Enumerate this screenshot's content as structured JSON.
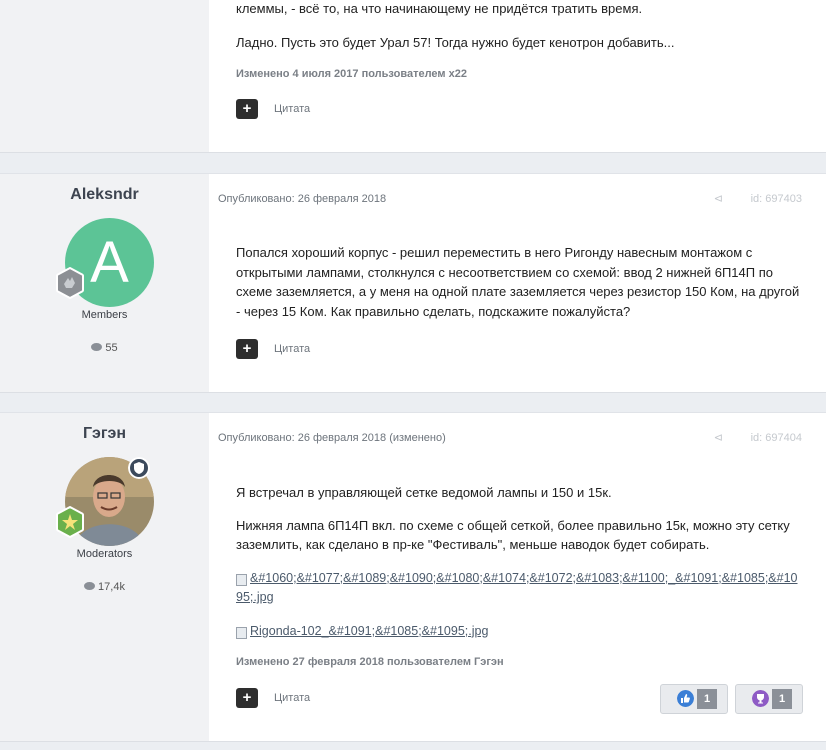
{
  "post1": {
    "lines": [
      "клеммы, - всё то, на что начинающему не придётся тратить время.",
      "Ладно. Пусть это будет Урал 57! Тогда нужно будет кенотрон добавить..."
    ],
    "edited": "Изменено 4 июля 2017 пользователем x22",
    "quote_label": "Цитата"
  },
  "post2": {
    "author": "Aleksndr",
    "avatar_letter": "A",
    "group": "Members",
    "post_count": "55",
    "published": "Опубликовано: 26 февраля 2018",
    "post_id": "id: 697403",
    "text": "Попался хороший корпус - решил переместить в него Ригонду навесным монтажом с открытыми лампами, столкнулся с несоответствием со схемой: ввод 2 нижней 6П14П по схеме заземляется, а у меня на одной плате заземляется через резистор 150 Ком, на другой - через 15 Ком. Как правильно сделать, подскажите пожалуйста?",
    "quote_label": "Цитата"
  },
  "post3": {
    "author": "Гэгэн",
    "group": "Moderators",
    "post_count": "17,4k",
    "published": "Опубликовано: 26 февраля 2018 (изменено)",
    "post_id": "id: 697404",
    "para1": "Я встречал в управляющей сетке ведомой лампы и 150 и 15к.",
    "para2": "Нижняя лампа 6П14П вкл. по схеме с общей сеткой, более правильно 15к, можно эту сетку заземлить, как сделано в пр-ке \"Фестиваль\", меньше наводок будет собирать.",
    "image1": "&#1060;&#1077;&#1089;&#1090;&#1080;&#1074;&#1072;&#1083;&#1100;_&#1091;&#1085;&#1095;.jpg",
    "image2": "Rigonda-102_&#1091;&#1085;&#1095;.jpg",
    "edited": "Изменено 27 февраля 2018 пользователем Гэгэн",
    "quote_label": "Цитата",
    "reactions": [
      {
        "icon": "like-icon",
        "color": "#3b7fd6",
        "count": "1"
      },
      {
        "icon": "trophy-icon",
        "color": "#8e5bc5",
        "count": "1"
      }
    ]
  }
}
